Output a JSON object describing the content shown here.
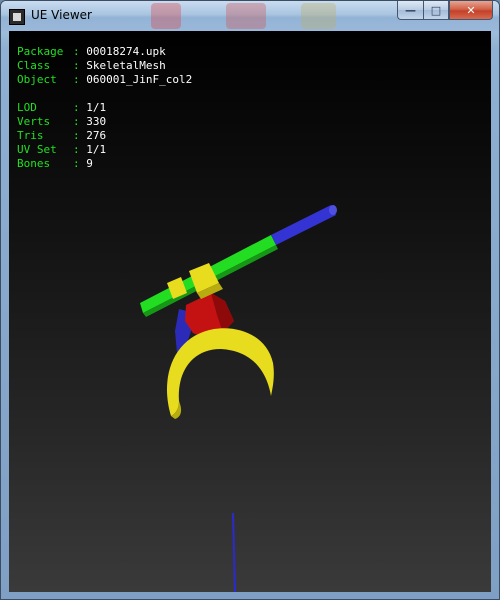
{
  "window": {
    "title": "UE Viewer",
    "controls": {
      "minimize": "—",
      "maximize": "□",
      "close": "✕"
    }
  },
  "info": {
    "block1": [
      {
        "key": "Package",
        "value": "00018274.upk"
      },
      {
        "key": "Class",
        "value": "SkeletalMesh"
      },
      {
        "key": "Object",
        "value": "060001_JinF_col2"
      }
    ],
    "block2": [
      {
        "key": "LOD",
        "value": "1/1"
      },
      {
        "key": "Verts",
        "value": "330"
      },
      {
        "key": "Tris",
        "value": "276"
      },
      {
        "key": "UV Set",
        "value": "1/1"
      },
      {
        "key": "Bones",
        "value": "9"
      }
    ]
  },
  "colors": {
    "label_green": "#20e020",
    "mesh_green": "#22dd22",
    "mesh_blue": "#3a3ad0",
    "mesh_yellow": "#e8dc1e",
    "mesh_red": "#c81414"
  }
}
